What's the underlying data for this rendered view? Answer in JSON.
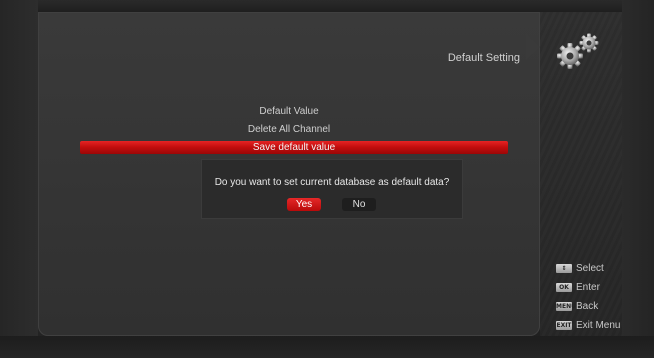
{
  "header": {
    "title": "Default Setting",
    "icon": "gears-icon"
  },
  "menu": {
    "items": [
      {
        "label": "Default Value",
        "selected": false
      },
      {
        "label": "Delete All Channel",
        "selected": false
      },
      {
        "label": "Save default value",
        "selected": true
      }
    ]
  },
  "dialog": {
    "message": "Do you want to set current database as default data?",
    "yes_label": "Yes",
    "no_label": "No",
    "focused": "Yes"
  },
  "legend": [
    {
      "key": "⇕",
      "label": "Select",
      "icon": "arrows-key-icon"
    },
    {
      "key": "OK",
      "label": "Enter",
      "icon": "ok-key-icon"
    },
    {
      "key": "MENU",
      "label": "Back",
      "icon": "menu-key-icon"
    },
    {
      "key": "EXIT",
      "label": "Exit Menu",
      "icon": "exit-key-icon"
    }
  ],
  "colors": {
    "highlight": "#c40e0e",
    "panel": "#353535",
    "text": "#cfcfcf"
  }
}
